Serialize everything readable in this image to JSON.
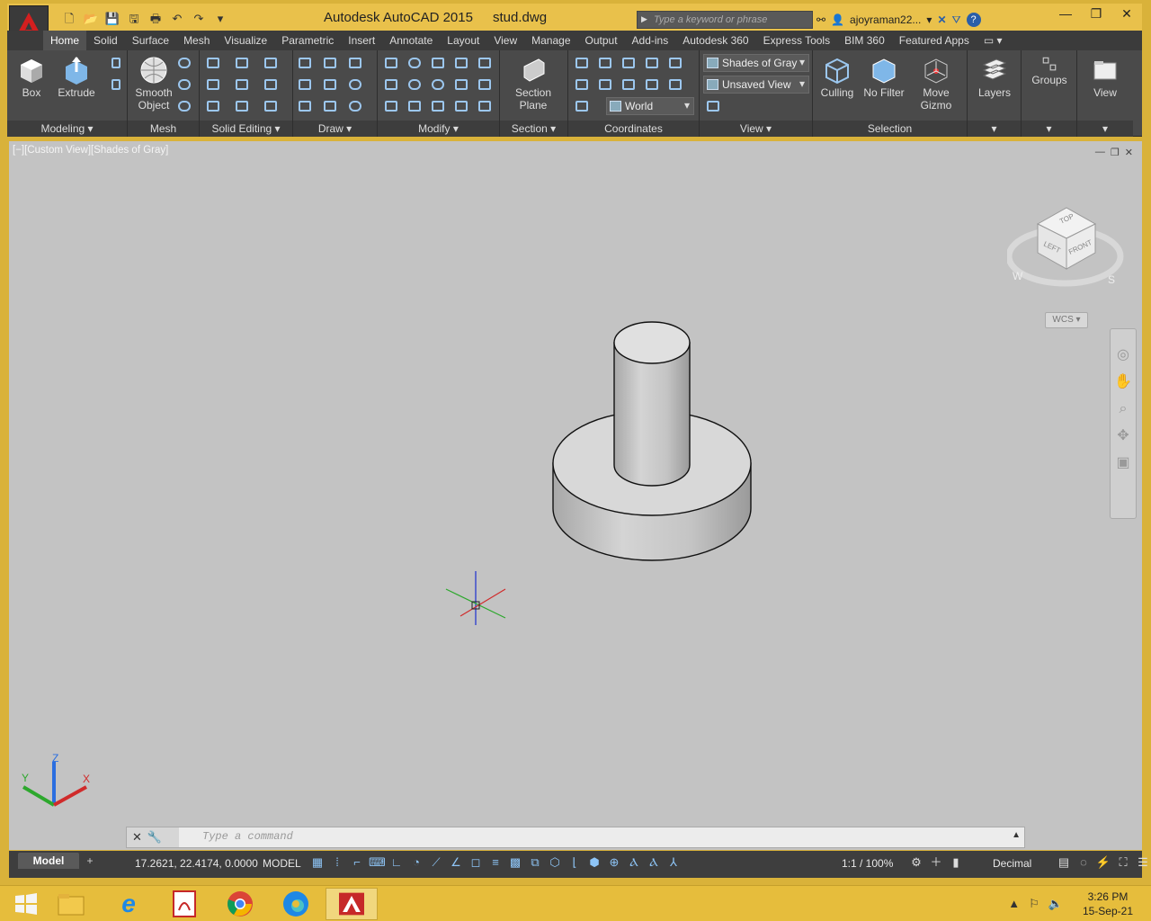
{
  "window": {
    "app_title": "Autodesk AutoCAD 2015",
    "file_name": "stud.dwg",
    "search_placeholder": "Type a keyword or phrase",
    "username": "ajoyraman22...",
    "controls": [
      "—",
      "❐",
      "✕"
    ]
  },
  "quick_access": [
    "🗋",
    "📂",
    "💾",
    "🖫",
    "🖶",
    "↶",
    "↷",
    "▾"
  ],
  "ribbon_tabs": [
    "Home",
    "Solid",
    "Surface",
    "Mesh",
    "Visualize",
    "Parametric",
    "Insert",
    "Annotate",
    "Layout",
    "View",
    "Manage",
    "Output",
    "Add-ins",
    "Autodesk 360",
    "Express Tools",
    "BIM 360",
    "Featured Apps"
  ],
  "active_tab": "Home",
  "ribbon": {
    "modeling": {
      "label": "Modeling ▾",
      "box": "Box",
      "extrude": "Extrude"
    },
    "mesh": {
      "label": "Mesh",
      "smooth_object": "Smooth\nObject"
    },
    "solid_editing": {
      "label": "Solid Editing ▾"
    },
    "draw": {
      "label": "Draw ▾"
    },
    "modify": {
      "label": "Modify ▾"
    },
    "section": {
      "label": "Section ▾",
      "section_plane": "Section\nPlane"
    },
    "coordinates": {
      "label": "Coordinates",
      "ucs_world": "World"
    },
    "view": {
      "label": "View ▾",
      "visual_style": "Shades of Gray",
      "named_view": "Unsaved View"
    },
    "selection": {
      "label": "Selection",
      "culling": "Culling",
      "no_filter": "No Filter",
      "move_gizmo": "Move\nGizmo"
    },
    "layers": "Layers",
    "groups": "Groups",
    "view_panel": "View"
  },
  "viewport": {
    "label": "[−][Custom View][Shades of Gray]",
    "viewcube": {
      "top": "TOP",
      "left": "LEFT",
      "front": "FRONT",
      "w": "W",
      "s": "S"
    },
    "wcs": "WCS ▾"
  },
  "command_line": {
    "placeholder": "Type a command"
  },
  "status_bar": {
    "model_tab": "Model",
    "coords": "17.2621, 22.4174, 0.0000",
    "mode": "MODEL",
    "scale": "1:1 / 100%",
    "units": "Decimal"
  },
  "taskbar": {
    "time": "3:26 PM",
    "date": "15-Sep-21"
  }
}
